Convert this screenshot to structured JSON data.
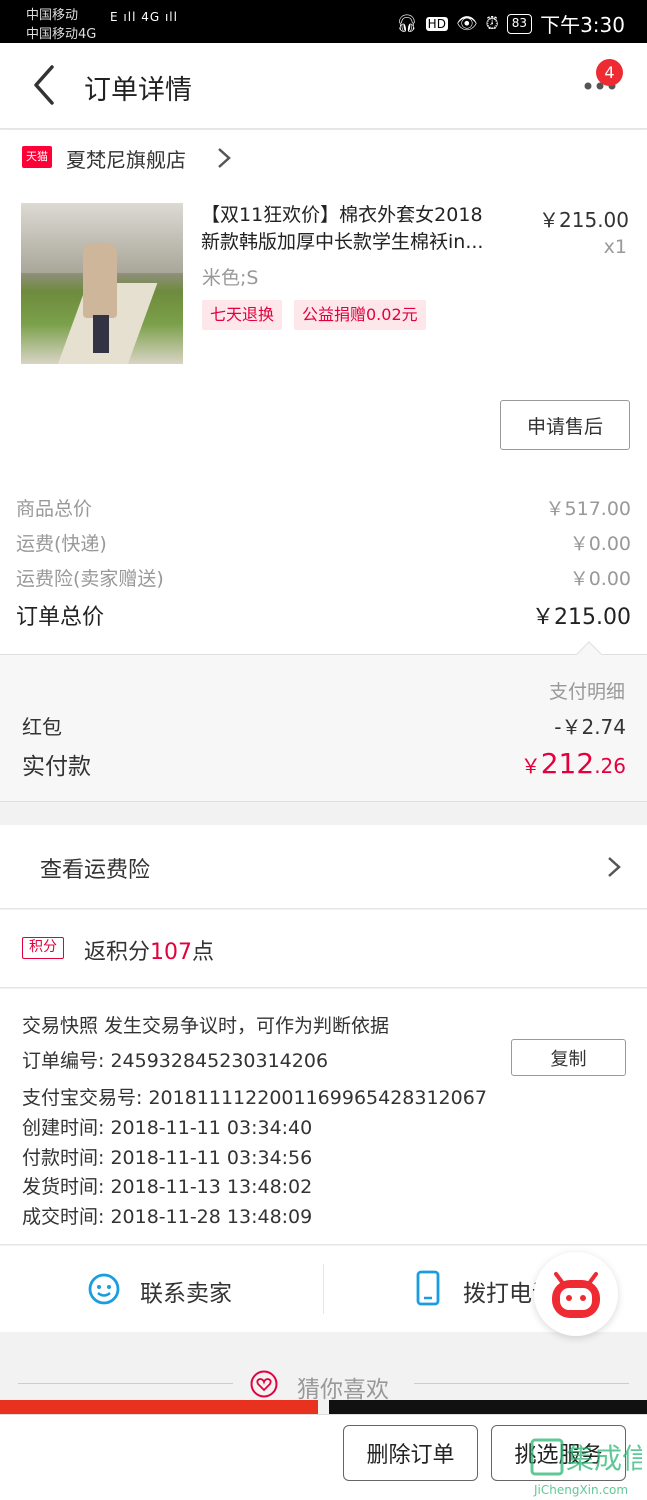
{
  "status_bar": {
    "carrier1": "中国移动",
    "carrier2": "中国移动4G",
    "signal": "E ıll 4G ıll",
    "battery": "83",
    "time": "下午3:30"
  },
  "header": {
    "title": "订单详情",
    "notification_count": "4"
  },
  "shop": {
    "logo_text": "天猫",
    "name": "夏梵尼旗舰店"
  },
  "product": {
    "title_line1": "【双11狂欢价】棉衣外套女2018",
    "title_line2": "新款韩版加厚中长款学生棉袄in...",
    "spec": "米色;S",
    "price": "￥215.00",
    "qty": "x1",
    "tags": [
      "七天退换",
      "公益捐赠0.02元"
    ],
    "aftersale_label": "申请售后"
  },
  "summary": {
    "rows": [
      {
        "label": "商品总价",
        "value": "￥517.00"
      },
      {
        "label": "运费(快递)",
        "value": "￥0.00"
      },
      {
        "label": "运费险(卖家赠送)",
        "value": "￥0.00"
      }
    ],
    "total_label": "订单总价",
    "total_value": "￥215.00"
  },
  "payment": {
    "title": "支付明细",
    "hongbao_label": "红包",
    "hongbao_value": "-￥2.74",
    "paid_label": "实付款",
    "paid_currency": "￥",
    "paid_int": "212",
    "paid_dec": ".26"
  },
  "insurance": {
    "label": "查看运费险"
  },
  "points": {
    "badge": "积分",
    "prefix": "返积分",
    "count": "107",
    "suffix": "点"
  },
  "snapshot": {
    "line0": "交易快照  发生交易争议时，可作为判断依据",
    "order_no": "订单编号: 245932845230314206",
    "alipay_no": "支付宝交易号: 2018111122001169965428312067",
    "created": "创建时间: 2018-11-11 03:34:40",
    "paid": "付款时间: 2018-11-11 03:34:56",
    "shipped": "发货时间: 2018-11-13 13:48:02",
    "completed": "成交时间: 2018-11-28 13:48:09",
    "copy_label": "复制"
  },
  "contact": {
    "seller_label": "联系卖家",
    "phone_label": "拨打电话"
  },
  "guess": {
    "label": "猜你喜欢"
  },
  "bottom": {
    "delete_label": "删除订单",
    "service_label": "挑选服务"
  },
  "colors": {
    "accent": "#e3003d",
    "badge": "#ee2a33",
    "tmall": "#ff0036",
    "contact_icon": "#1a9de0"
  },
  "watermark": {
    "cn": "集成信",
    "url": "JiChengXin.com"
  }
}
